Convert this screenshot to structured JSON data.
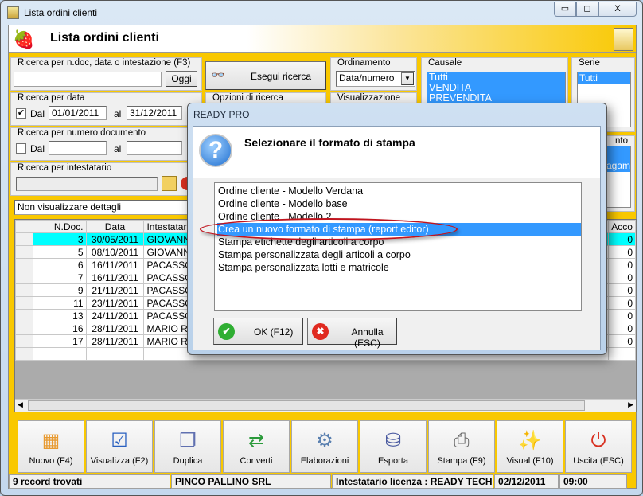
{
  "window": {
    "title": "Lista ordini clienti",
    "minimize": "▭",
    "maximize": "◻",
    "close": "X"
  },
  "header": {
    "title": "Lista ordini clienti"
  },
  "search_ndoc": {
    "legend": "Ricerca per n.doc, data o intestazione (F3)",
    "value": "",
    "today_button": "Oggi"
  },
  "search_date": {
    "legend": "Ricerca per data",
    "checked": true,
    "from_label": "Dal",
    "from": "01/01/2011",
    "to_label": "al",
    "to": "31/12/2011"
  },
  "search_number": {
    "legend": "Ricerca per numero documento",
    "checked": false,
    "from_label": "Dal",
    "from": "",
    "to_label": "al",
    "to": ""
  },
  "search_holder": {
    "legend": "Ricerca per intestatario",
    "value": ""
  },
  "details_select": {
    "value": "Non visualizzare dettagli"
  },
  "run_search": {
    "label": "Esegui ricerca"
  },
  "options": {
    "legend": "Opzioni di ricerca"
  },
  "sorting": {
    "legend": "Ordinamento",
    "value": "Data/numero"
  },
  "view": {
    "legend": "Visualizzazione"
  },
  "causale": {
    "legend": "Causale",
    "items": [
      "Tutti",
      "VENDITA",
      "PREVENDITA"
    ]
  },
  "serie": {
    "legend": "Serie",
    "items": [
      "Tutti"
    ]
  },
  "payment": {
    "legend": "nto",
    "items": [
      "",
      "agam"
    ]
  },
  "grid": {
    "columns": [
      "N.Doc.",
      "Data",
      "Intestatario",
      "Acco"
    ],
    "rows": [
      [
        "3",
        "30/05/2011",
        "GIOVANNI",
        "0"
      ],
      [
        "5",
        "08/10/2011",
        "GIOVANNI",
        "0"
      ],
      [
        "6",
        "16/11/2011",
        "PACASSON",
        "0"
      ],
      [
        "7",
        "16/11/2011",
        "PACASSON",
        "0"
      ],
      [
        "9",
        "21/11/2011",
        "PACASSON",
        "0"
      ],
      [
        "11",
        "23/11/2011",
        "PACASSON",
        "0"
      ],
      [
        "13",
        "24/11/2011",
        "PACASSON",
        "0"
      ],
      [
        "16",
        "28/11/2011",
        "MARIO RO",
        "0"
      ],
      [
        "17",
        "28/11/2011",
        "MARIO RO",
        "0"
      ]
    ]
  },
  "toolbar": [
    {
      "label": "Nuovo (F4)",
      "icon": "grid-add-icon"
    },
    {
      "label": "Visualizza (F2)",
      "icon": "grid-check-icon"
    },
    {
      "label": "Duplica",
      "icon": "duplicate-icon"
    },
    {
      "label": "Converti",
      "icon": "convert-icon"
    },
    {
      "label": "Elaborazioni",
      "icon": "gear-document-icon"
    },
    {
      "label": "Esporta",
      "icon": "database-export-icon"
    },
    {
      "label": "Stampa (F9)",
      "icon": "printer-icon"
    },
    {
      "label": "Visual (F10)",
      "icon": "magic-wand-icon"
    },
    {
      "label": "Uscita (ESC)",
      "icon": "power-icon"
    }
  ],
  "status": {
    "records": "9 record trovati",
    "company": "PINCO PALLINO SRL",
    "license": "Intestatario licenza : READY TECH",
    "date": "02/12/2011",
    "time": "09:00"
  },
  "dialog": {
    "title": "READY PRO",
    "heading": "Selezionare il formato di stampa",
    "items": [
      "Ordine cliente - Modello Verdana",
      "Ordine cliente - Modello base",
      "Ordine cliente - Modello 2",
      "Crea un nuovo formato di stampa (report editor)",
      "Stampa etichette degli articoli a corpo",
      "Stampa personalizzata degli articoli a corpo",
      "Stampa personalizzata lotti e matricole"
    ],
    "selected_index": 3,
    "ok": "OK (F12)",
    "cancel": "Annulla (ESC)"
  },
  "colors": {
    "panel": "#f9c800",
    "selection": "#3399ff",
    "current_row": "#00ffff",
    "highlight_ring": "#c0141e"
  }
}
